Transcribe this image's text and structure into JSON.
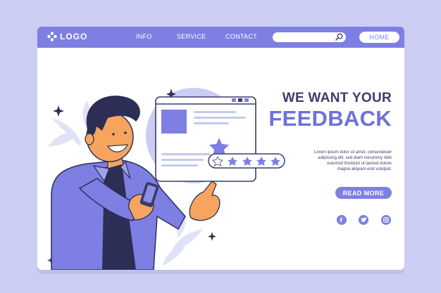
{
  "navbar": {
    "logo_text": "LOGO",
    "logo_icon": "diamond-dots-icon",
    "items": [
      "INFO",
      "SERVICE",
      "CONTACT"
    ],
    "search_placeholder": "",
    "home_label": "HOME"
  },
  "hero": {
    "headline_line1": "WE WANT YOUR",
    "headline_line2": "FEEDBACK",
    "body_line1": "Lorem ipsum dolor sit amet, consectetuer",
    "body_line2": "adipiscing elit, sed diam nonummy nibh",
    "body_line3": "euismod tincidunt ut laoreet dolore",
    "body_line4": "magna aliquam erat volutpat.",
    "read_more_label": "READ MORE"
  },
  "rating": {
    "value": 4,
    "max": 5
  },
  "social": [
    "facebook-icon",
    "twitter-icon",
    "instagram-icon"
  ],
  "colors": {
    "background": "#cbcdf2",
    "accent": "#7d7fe3",
    "dark_text": "#3b3d66",
    "headline_accent": "#6f71d9"
  }
}
